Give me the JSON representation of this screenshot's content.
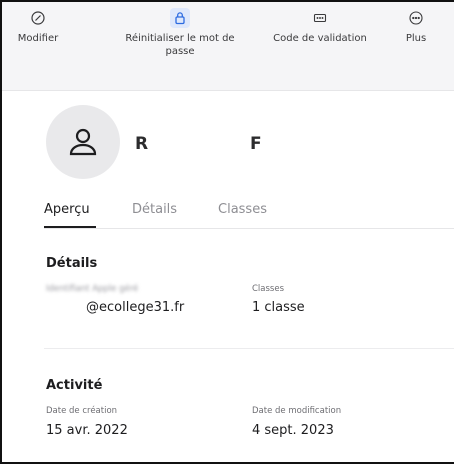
{
  "toolbar": {
    "modify_label": "Modifier",
    "reset_label": "Réinitialiser le mot de passe",
    "code_label": "Code de validation",
    "more_label": "Plus"
  },
  "profile": {
    "first_initial": "R",
    "last_initial": "F"
  },
  "tabs": [
    {
      "label": "Aperçu",
      "active": true
    },
    {
      "label": "Détails",
      "active": false
    },
    {
      "label": "Classes",
      "active": false
    }
  ],
  "details": {
    "title": "Détails",
    "account_label": "Identifiant Apple géré",
    "account_value": "@ecollege31.fr",
    "classes_label": "Classes",
    "classes_value": "1 classe"
  },
  "activity": {
    "title": "Activité",
    "created_label": "Date de création",
    "created_value": "15 avr. 2022",
    "modified_label": "Date de modification",
    "modified_value": "4 sept. 2023"
  },
  "colors": {
    "accent": "#2d6be0",
    "toolbar_bg": "#f5f5f7",
    "avatar_bg": "#e9e9eb"
  },
  "icons": {
    "modify": "slash-circle-icon",
    "reset": "lock-icon",
    "code": "keypad-icon",
    "more": "ellipsis-circle-icon",
    "avatar": "person-icon"
  }
}
